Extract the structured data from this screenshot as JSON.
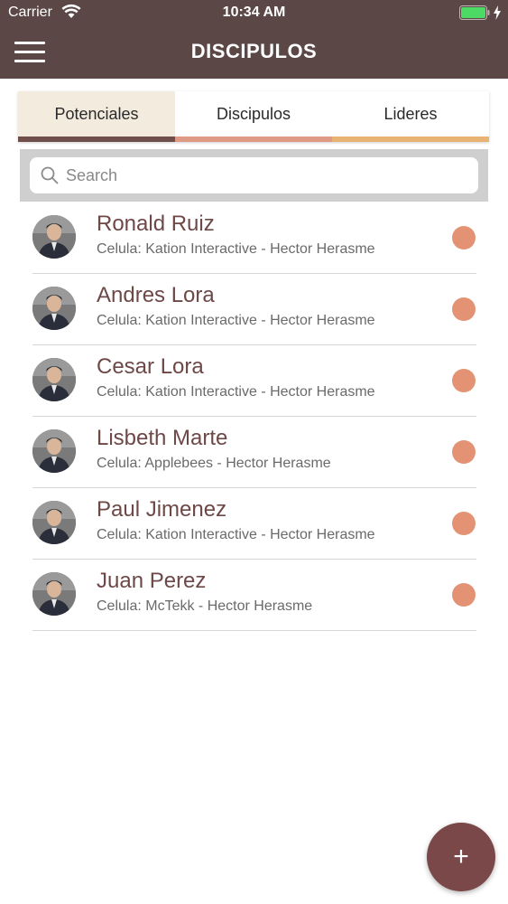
{
  "status_bar": {
    "carrier": "Carrier",
    "time": "10:34 AM",
    "battery_color": "#4cd964"
  },
  "header": {
    "title": "DISCIPULOS",
    "menu_icon": "hamburger-icon",
    "background": "#5a4746"
  },
  "tabs": [
    {
      "label": "Potenciales",
      "active": true,
      "bar_color": "#6e4f4b",
      "bg": "#f2ebde"
    },
    {
      "label": "Discipulos",
      "active": false,
      "bar_color": "#de9a85",
      "bg": "#ffffff"
    },
    {
      "label": "Lideres",
      "active": false,
      "bar_color": "#e8b273",
      "bg": "#ffffff"
    }
  ],
  "search": {
    "placeholder": "Search",
    "value": ""
  },
  "people": [
    {
      "name": "Ronald Ruiz",
      "subtitle": "Celula: Kation Interactive - Hector Herasme",
      "dot_color": "#e39373"
    },
    {
      "name": "Andres Lora",
      "subtitle": "Celula: Kation Interactive - Hector Herasme",
      "dot_color": "#e39373"
    },
    {
      "name": "Cesar Lora",
      "subtitle": "Celula: Kation Interactive - Hector Herasme",
      "dot_color": "#e39373"
    },
    {
      "name": "Lisbeth Marte",
      "subtitle": "Celula: Applebees - Hector Herasme",
      "dot_color": "#e39373"
    },
    {
      "name": "Paul Jimenez",
      "subtitle": "Celula: Kation Interactive - Hector Herasme",
      "dot_color": "#e39373"
    },
    {
      "name": "Juan Perez",
      "subtitle": "Celula: McTekk - Hector Herasme",
      "dot_color": "#e39373"
    }
  ],
  "fab": {
    "label": "+",
    "color": "#7a4848"
  }
}
